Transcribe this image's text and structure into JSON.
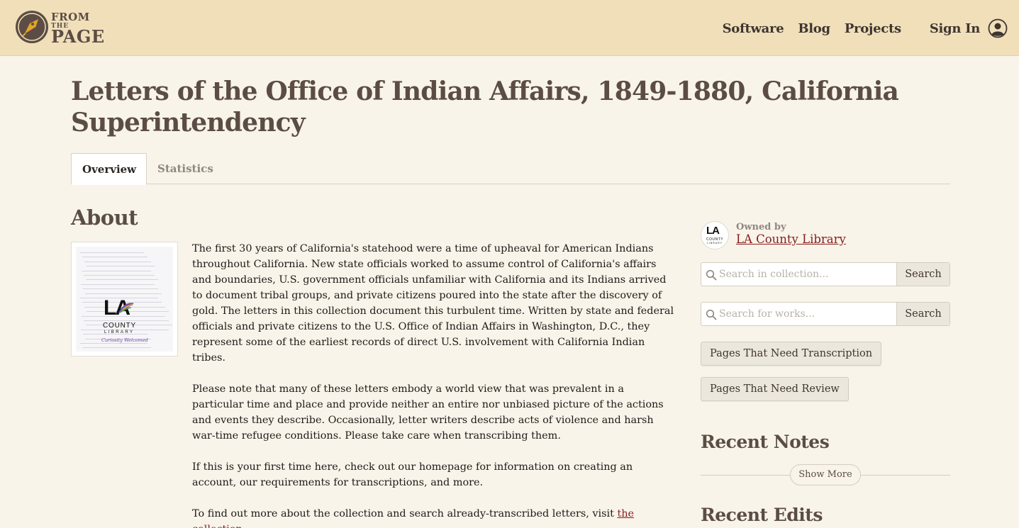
{
  "header": {
    "logo": {
      "line1": "FROM",
      "line2": "THE",
      "line3": "PAGE"
    },
    "nav": [
      {
        "label": "Software"
      },
      {
        "label": "Blog"
      },
      {
        "label": "Projects"
      }
    ],
    "sign_in": "Sign In"
  },
  "collection": {
    "title": "Letters of the Office of Indian Affairs, 1849-1880, California Superintendency",
    "tabs": [
      {
        "label": "Overview",
        "active": true
      },
      {
        "label": "Statistics",
        "active": false
      }
    ]
  },
  "about": {
    "heading": "About",
    "thumbnail": {
      "logo_la": "LA",
      "logo_county": "COUNTY",
      "logo_library": "LIBRARY",
      "logo_tagline": "Curiosity Welcomed"
    },
    "paragraphs": [
      "The first 30 years of California's statehood were a time of upheaval for American Indians throughout California. New state officials worked to assume control of California's affairs and boundaries, U.S. government officials unfamiliar with California and its Indians arrived to document tribal groups, and private citizens poured into the state after the discovery of gold. The letters in this collection document this turbulent time. Written by state and federal officials and private citizens to the U.S. Office of Indian Affairs in Washington, D.C., they represent some of the earliest records of direct U.S. involvement with California Indian tribes.",
      "Please note that many of these letters embody a world view that was prevalent in a particular time and place and provide neither an entire nor unbiased picture of the actions and events they describe. Occasionally, letter writers describe acts of violence and harsh war-time refugee conditions. Please take care when transcribing them.",
      "If this is your first time here, check out our homepage for information on creating an account, our requirements for transcriptions, and more."
    ],
    "last_paragraph_text": "To find out more about the collection and search already-transcribed letters, visit ",
    "last_paragraph_link": "the collection",
    "last_paragraph_end": "."
  },
  "sidebar": {
    "owned_by_label": "Owned by",
    "owner_name": "LA County Library",
    "owner_logo": {
      "la": "LA",
      "county": "COUNTY",
      "library": "LIBRARY"
    },
    "search_collection": {
      "placeholder": "Search in collection...",
      "button": "Search"
    },
    "search_works": {
      "placeholder": "Search for works...",
      "button": "Search"
    },
    "pages_need_transcription": "Pages That Need Transcription",
    "pages_need_review": "Pages That Need Review",
    "recent_notes_heading": "Recent Notes",
    "show_more": "Show More",
    "recent_edits_heading": "Recent Edits"
  },
  "colors": {
    "header_bg": "#f0dfb9",
    "page_bg": "#f8f4ea",
    "heading": "#5c4d44",
    "link": "#8a1c1c",
    "button_bg": "#ece7dd"
  }
}
